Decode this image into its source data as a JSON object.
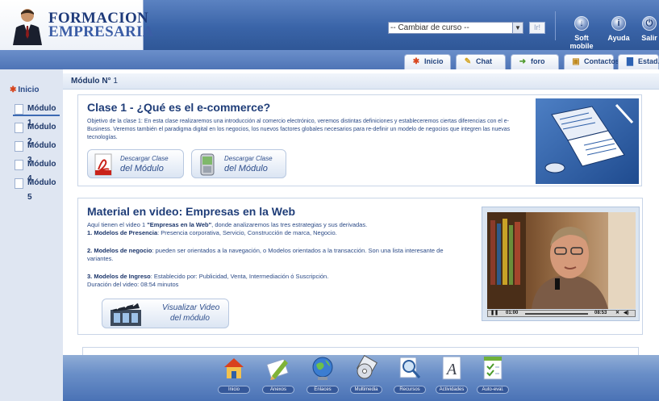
{
  "header": {
    "logo_line1": "FORMACION",
    "logo_line2": "EMPRESARIA",
    "course_select": "-- Cambiar de curso --",
    "go_label": "Ir!",
    "tools": [
      {
        "label": "Soft mobile",
        "icon": "download-circle-icon"
      },
      {
        "label": "Ayuda",
        "icon": "info-circle-icon"
      },
      {
        "label": "Salir",
        "icon": "power-circle-icon"
      }
    ]
  },
  "tabs": [
    {
      "label": "Inicio",
      "icon": "home-icon"
    },
    {
      "label": "Chat",
      "icon": "chat-icon"
    },
    {
      "label": "foro",
      "icon": "forum-icon"
    },
    {
      "label": "Contactos",
      "icon": "contacts-icon"
    },
    {
      "label": "Estad.",
      "icon": "stats-icon"
    }
  ],
  "sidebar": {
    "home": "Inicio",
    "modules": [
      "Módulo 1",
      "Módulo 2",
      "Módulo 3",
      "Módulo 4",
      "Módulo 5"
    ],
    "active_index": 0
  },
  "module_header": {
    "label": "Módulo N°",
    "number": "1"
  },
  "clase": {
    "title": "Clase 1 - ¿Qué es el e-commerce?",
    "description": "Objetivo de la clase 1: En esta clase realizaremos una introducción al comercio electrónico, veremos distintas definiciones y estableceremos ciertas diferencias con el e-Business. Veremos también el paradigma digital en los negocios, los nuevos factores globales necesarios para re-definir un modelo de negocios que integren las nuevas tecnologías.",
    "download_pdf": {
      "line1": "Descargar Clase",
      "line2": "del Módulo"
    },
    "download_mobile": {
      "line1": "Descargar Clase",
      "line2": "del Módulo"
    }
  },
  "video_section": {
    "title": "Material en video: Empresas en la Web",
    "intro_prefix": "Aquí tienen el video 1 ",
    "intro_bold": "\"Empresas en la Web\"",
    "intro_suffix": ", donde analizaremos las tres estrategias y sus derivadas.",
    "p1_bold": "1. Modelos de Presencia",
    "p1_text": ": Presencia corporativa, Servicio, Construcción de marca, Negocio.",
    "p2_bold": "2. Modelos de negocio",
    "p2_text": ": pueden ser orientados a la navegación, o Modelos orientados a la transacción. Son una lista interesante de variantes.",
    "p3_bold": "3. Modelos de Ingreso",
    "p3_text": ": Establecido por: Publicidad, Venta, Intermediación ó Suscripción.",
    "duration": "Duración del video: 08:54 minutos",
    "button": {
      "line1": "Visualizar Video",
      "line2": "del módulo"
    },
    "player": {
      "current": "01:00",
      "total": "08:53"
    }
  },
  "bottom_tools": [
    {
      "label": "Inicio",
      "icon": "home-icon"
    },
    {
      "label": "Anexos",
      "icon": "pencil-icon"
    },
    {
      "label": "Enlaces",
      "icon": "globe-icon"
    },
    {
      "label": "Multimedia",
      "icon": "disc-icon"
    },
    {
      "label": "Recursos",
      "icon": "magnifier-icon"
    },
    {
      "label": "Actividades",
      "icon": "letter-a-icon"
    },
    {
      "label": "Auto-eval.",
      "icon": "checklist-icon"
    }
  ]
}
